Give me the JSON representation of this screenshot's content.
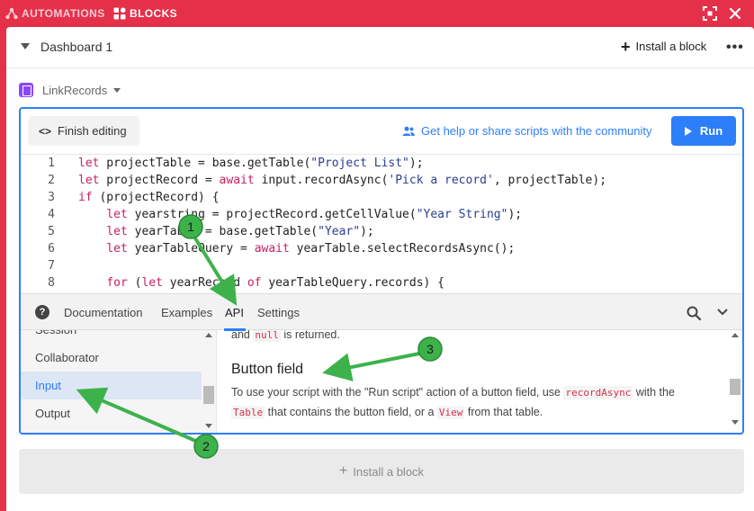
{
  "topbar": {
    "automations_label": "AUTOMATIONS",
    "blocks_label": "BLOCKS"
  },
  "dashboard": {
    "title": "Dashboard 1",
    "install_block_label": "Install a block",
    "more_label": "•••"
  },
  "block": {
    "name": "LinkRecords",
    "accent_color": "#8b46ff"
  },
  "editor": {
    "finish_editing_label": "Finish editing",
    "help_link_label": "Get help or share scripts with the community",
    "run_label": "Run",
    "code_lines": [
      {
        "n": "1",
        "segments": [
          [
            "kw",
            "let"
          ],
          [
            "t",
            " projectTable = base.getTable("
          ],
          [
            "str",
            "\"Project List\""
          ],
          [
            "t",
            ");"
          ]
        ]
      },
      {
        "n": "2",
        "segments": [
          [
            "kw",
            "let"
          ],
          [
            "t",
            " projectRecord = "
          ],
          [
            "kw",
            "await"
          ],
          [
            "t",
            " input.recordAsync("
          ],
          [
            "str",
            "'Pick a record'"
          ],
          [
            "t",
            ", projectTable);"
          ]
        ]
      },
      {
        "n": "3",
        "segments": [
          [
            "kw",
            "if"
          ],
          [
            "t",
            " (projectRecord) {"
          ]
        ]
      },
      {
        "n": "4",
        "segments": [
          [
            "t",
            "    "
          ],
          [
            "kw",
            "let"
          ],
          [
            "t",
            " yearstring = projectRecord.getCellValue("
          ],
          [
            "str",
            "\"Year String\""
          ],
          [
            "t",
            ");"
          ]
        ]
      },
      {
        "n": "5",
        "segments": [
          [
            "t",
            "    "
          ],
          [
            "kw",
            "let"
          ],
          [
            "t",
            " yearTable = base.getTable("
          ],
          [
            "str",
            "\"Year\""
          ],
          [
            "t",
            ");"
          ]
        ]
      },
      {
        "n": "6",
        "segments": [
          [
            "t",
            "    "
          ],
          [
            "kw",
            "let"
          ],
          [
            "t",
            " yearTableQuery = "
          ],
          [
            "kw",
            "await"
          ],
          [
            "t",
            " yearTable.selectRecordsAsync();"
          ]
        ]
      },
      {
        "n": "7",
        "segments": []
      },
      {
        "n": "8",
        "segments": [
          [
            "t",
            "    "
          ],
          [
            "kw",
            "for"
          ],
          [
            "t",
            " ("
          ],
          [
            "kw",
            "let"
          ],
          [
            "t",
            " yearRecord "
          ],
          [
            "kw",
            "of"
          ],
          [
            "t",
            " yearTableQuery.records) {"
          ]
        ]
      }
    ]
  },
  "reference": {
    "tabs": {
      "documentation": "Documentation",
      "examples": "Examples",
      "api": "API",
      "settings": "Settings"
    },
    "active_tab": "API",
    "sidebar_items": [
      "Session",
      "Collaborator",
      "Input",
      "Output"
    ],
    "active_sidebar_item": "Input",
    "content": {
      "line0_pre": "and ",
      "line0_code": "null",
      "line0_post": " is returned.",
      "heading": "Button field",
      "p1_pre": "To use your script with the \"Run script\" action of a button field, use ",
      "p1_code": "recordAsync",
      "p1_post": " with the",
      "p2_code1": "Table",
      "p2_mid": " that contains the button field, or a ",
      "p2_code2": "View",
      "p2_post": " from that table."
    }
  },
  "install_bottom_label": "Install a block",
  "annotations": {
    "badges": [
      "1",
      "2",
      "3"
    ],
    "color": "#3db24b"
  },
  "colors": {
    "header_red": "#e5304a",
    "accent_blue": "#2d7ff9",
    "keyword": "#c51f64",
    "string": "#2a3d8f"
  }
}
